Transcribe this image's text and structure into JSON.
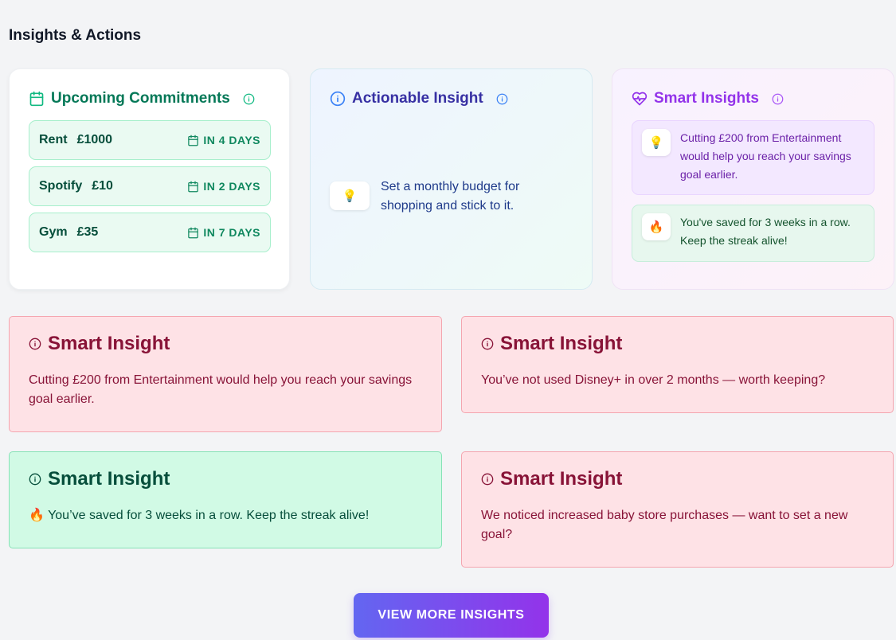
{
  "section": {
    "title": "Insights & Actions"
  },
  "commitments": {
    "title": "Upcoming Commitments",
    "items": [
      {
        "name": "Rent",
        "amount": "£1000",
        "due": "IN 4 DAYS"
      },
      {
        "name": "Spotify",
        "amount": "£10",
        "due": "IN 2 DAYS"
      },
      {
        "name": "Gym",
        "amount": "£35",
        "due": "IN 7 DAYS"
      }
    ]
  },
  "actionable": {
    "title": "Actionable Insight",
    "emoji": "💡",
    "text": "Set a monthly budget for shopping and stick to it."
  },
  "smart_insights_panel": {
    "title": "Smart Insights",
    "items": [
      {
        "emoji": "💡",
        "text": "Cutting £200 from Entertainment would help you reach your savings goal earlier."
      },
      {
        "emoji": "🔥",
        "text": "You've saved for 3 weeks in a row. Keep the streak alive!"
      }
    ]
  },
  "insight_cards": [
    {
      "title": "Smart Insight",
      "body": "Cutting £200 from Entertainment would help you reach your savings goal earlier.",
      "tone": "red"
    },
    {
      "title": "Smart Insight",
      "body": "You’ve not used Disney+ in over 2 months — worth keeping?",
      "tone": "red"
    },
    {
      "title": "Smart Insight",
      "body": "🔥 You’ve saved for 3 weeks in a row. Keep the streak alive!",
      "tone": "green"
    },
    {
      "title": "Smart Insight",
      "body": "We noticed increased baby store purchases — want to set a new goal?",
      "tone": "red"
    }
  ],
  "view_more_button": {
    "label": "VIEW MORE INSIGHTS"
  },
  "colors": {
    "commitments_accent": "#10b981",
    "actionable_accent": "#3b82f6",
    "smart_accent": "#9333ea",
    "alert_red": "#881337",
    "success_green": "#064e3b"
  }
}
